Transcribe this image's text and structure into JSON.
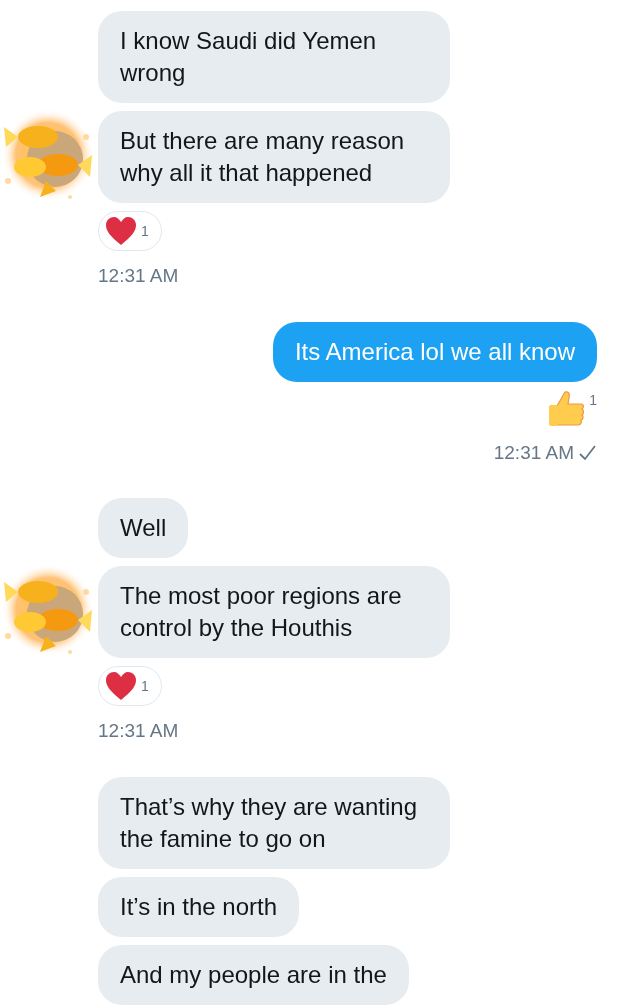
{
  "groups": [
    {
      "outgoing": false,
      "avatar": {
        "kind": "picture"
      },
      "messages": [
        "I know Saudi did Yemen wrong",
        "But there are many reason why all it that happened"
      ],
      "reaction": {
        "kind": "heart",
        "count": "1"
      },
      "time": "12:31 AM"
    },
    {
      "outgoing": true,
      "messages": [
        "Its America lol we all know"
      ],
      "reaction": {
        "kind": "thumbs-up",
        "count": "1"
      },
      "time": "12:31 AM",
      "read": true
    },
    {
      "outgoing": false,
      "avatar": {
        "kind": "picture"
      },
      "messages": [
        "Well",
        "The most poor regions are control by the Houthis"
      ],
      "reaction": {
        "kind": "heart",
        "count": "1"
      },
      "time": "12:31 AM"
    },
    {
      "outgoing": false,
      "messages": [
        "That’s why they are wanting the famine to go on",
        "It’s in the north",
        "And my people are in the"
      ]
    }
  ]
}
